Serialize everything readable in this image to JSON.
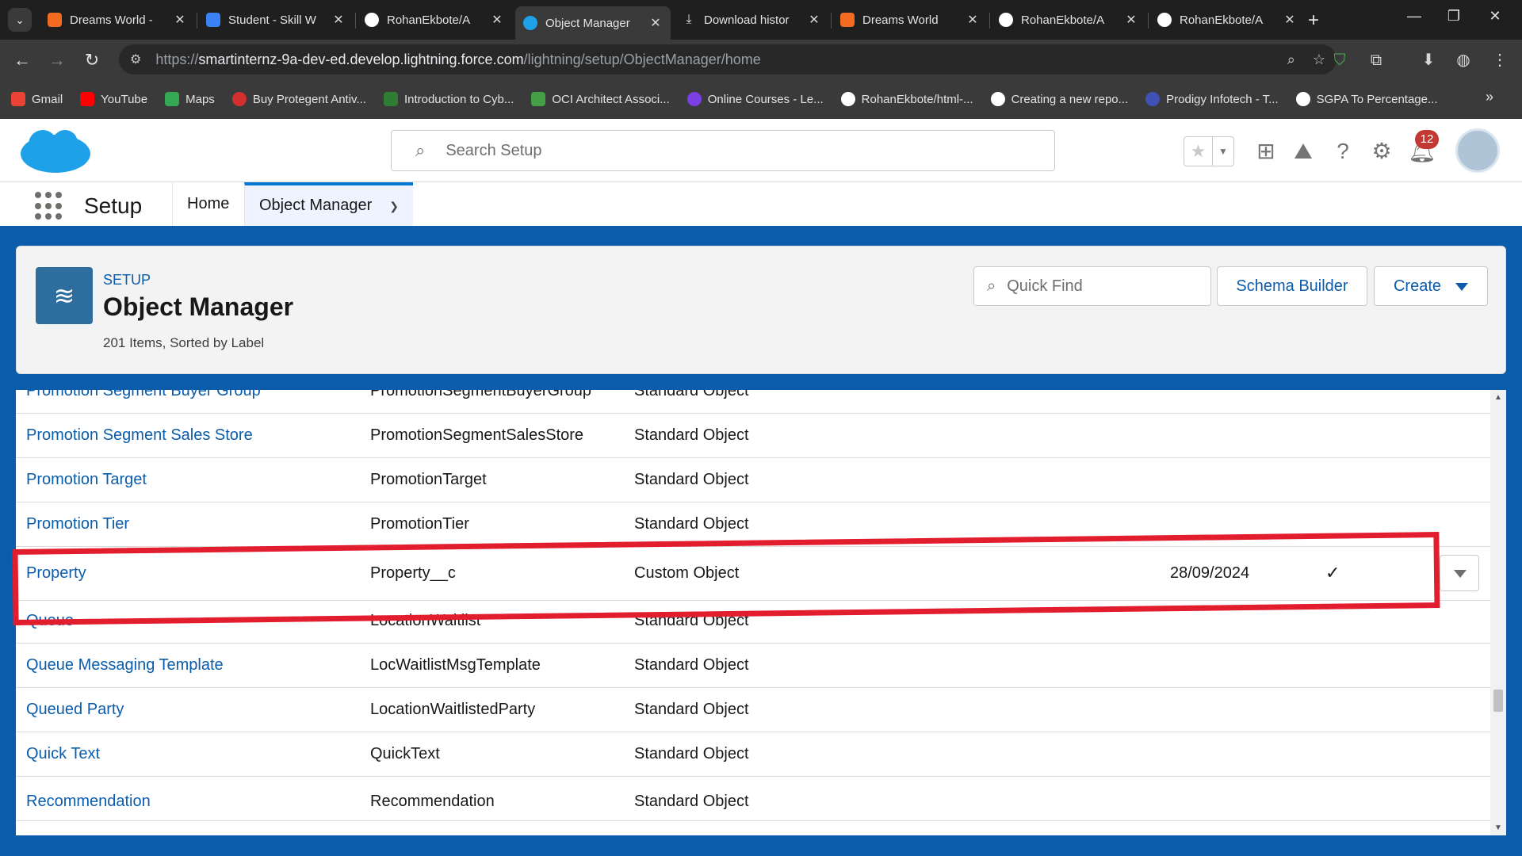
{
  "browser": {
    "tabs": [
      {
        "title": "Dreams World -",
        "icon": "salesforce-trailhead-icon",
        "color": "#f26b21"
      },
      {
        "title": "Student - Skill W",
        "icon": "skillwallet-icon",
        "color": "#3b82f6"
      },
      {
        "title": "RohanEkbote/A",
        "icon": "github-icon",
        "color": "#ffffff"
      },
      {
        "title": "Object Manager",
        "icon": "salesforce-cloud-icon",
        "color": "#1ea1e9"
      },
      {
        "title": "Download histor",
        "icon": "download-icon",
        "color": "#e3e3e3"
      },
      {
        "title": "Dreams World",
        "icon": "salesforce-trailhead-icon",
        "color": "#f26b21"
      },
      {
        "title": "RohanEkbote/A",
        "icon": "github-icon",
        "color": "#ffffff"
      },
      {
        "title": "RohanEkbote/A",
        "icon": "github-icon",
        "color": "#ffffff"
      }
    ],
    "url_prefix": "https://",
    "url_host": "smartinternz-9a-dev-ed.develop.lightning.force.com",
    "url_path": "/lightning/setup/ObjectManager/home",
    "bookmarks": [
      {
        "label": "Gmail",
        "color": "#ea4335"
      },
      {
        "label": "YouTube",
        "color": "#ff0000"
      },
      {
        "label": "Maps",
        "color": "#34a853"
      },
      {
        "label": "Buy Protegent Antiv...",
        "color": "#d32f2f"
      },
      {
        "label": "Introduction to Cyb...",
        "color": "#2e7d32"
      },
      {
        "label": "OCI Architect Associ...",
        "color": "#43a047"
      },
      {
        "label": "Online Courses - Le...",
        "color": "#7b3fe4"
      },
      {
        "label": "RohanEkbote/html-...",
        "color": "#ffffff"
      },
      {
        "label": "Creating a new repo...",
        "color": "#ffffff"
      },
      {
        "label": "Prodigy Infotech - T...",
        "color": "#3f51b5"
      },
      {
        "label": "SGPA To Percentage...",
        "color": "#ffffff"
      }
    ]
  },
  "sf_header": {
    "search_placeholder": "Search Setup",
    "notification_count": "12"
  },
  "app_nav": {
    "app_name": "Setup",
    "items": [
      "Home",
      "Object Manager"
    ]
  },
  "om_header": {
    "eyebrow": "SETUP",
    "title": "Object Manager",
    "subtitle": "201 Items, Sorted by Label",
    "quick_find_placeholder": "Quick Find",
    "schema_builder_label": "Schema Builder",
    "create_label": "Create"
  },
  "table": {
    "rows": [
      {
        "label": "Promotion Segment Buyer Group",
        "api": "PromotionSegmentBuyerGroup",
        "type": "Standard Object",
        "modified": "",
        "deployed": false
      },
      {
        "label": "Promotion Segment Sales Store",
        "api": "PromotionSegmentSalesStore",
        "type": "Standard Object",
        "modified": "",
        "deployed": false
      },
      {
        "label": "Promotion Target",
        "api": "PromotionTarget",
        "type": "Standard Object",
        "modified": "",
        "deployed": false
      },
      {
        "label": "Promotion Tier",
        "api": "PromotionTier",
        "type": "Standard Object",
        "modified": "",
        "deployed": false
      },
      {
        "label": "Property",
        "api": "Property__c",
        "type": "Custom Object",
        "modified": "28/09/2024",
        "deployed": true
      },
      {
        "label": "Queue",
        "api": "LocationWaitlist",
        "type": "Standard Object",
        "modified": "",
        "deployed": false
      },
      {
        "label": "Queue Messaging Template",
        "api": "LocWaitlistMsgTemplate",
        "type": "Standard Object",
        "modified": "",
        "deployed": false
      },
      {
        "label": "Queued Party",
        "api": "LocationWaitlistedParty",
        "type": "Standard Object",
        "modified": "",
        "deployed": false
      },
      {
        "label": "Quick Text",
        "api": "QuickText",
        "type": "Standard Object",
        "modified": "",
        "deployed": false
      },
      {
        "label": "Recommendation",
        "api": "Recommendation",
        "type": "Standard Object",
        "modified": "",
        "deployed": false
      }
    ],
    "check_glyph": "✓"
  },
  "colors": {
    "brand": "#0b5cab",
    "highlight": "#e11d2e"
  }
}
